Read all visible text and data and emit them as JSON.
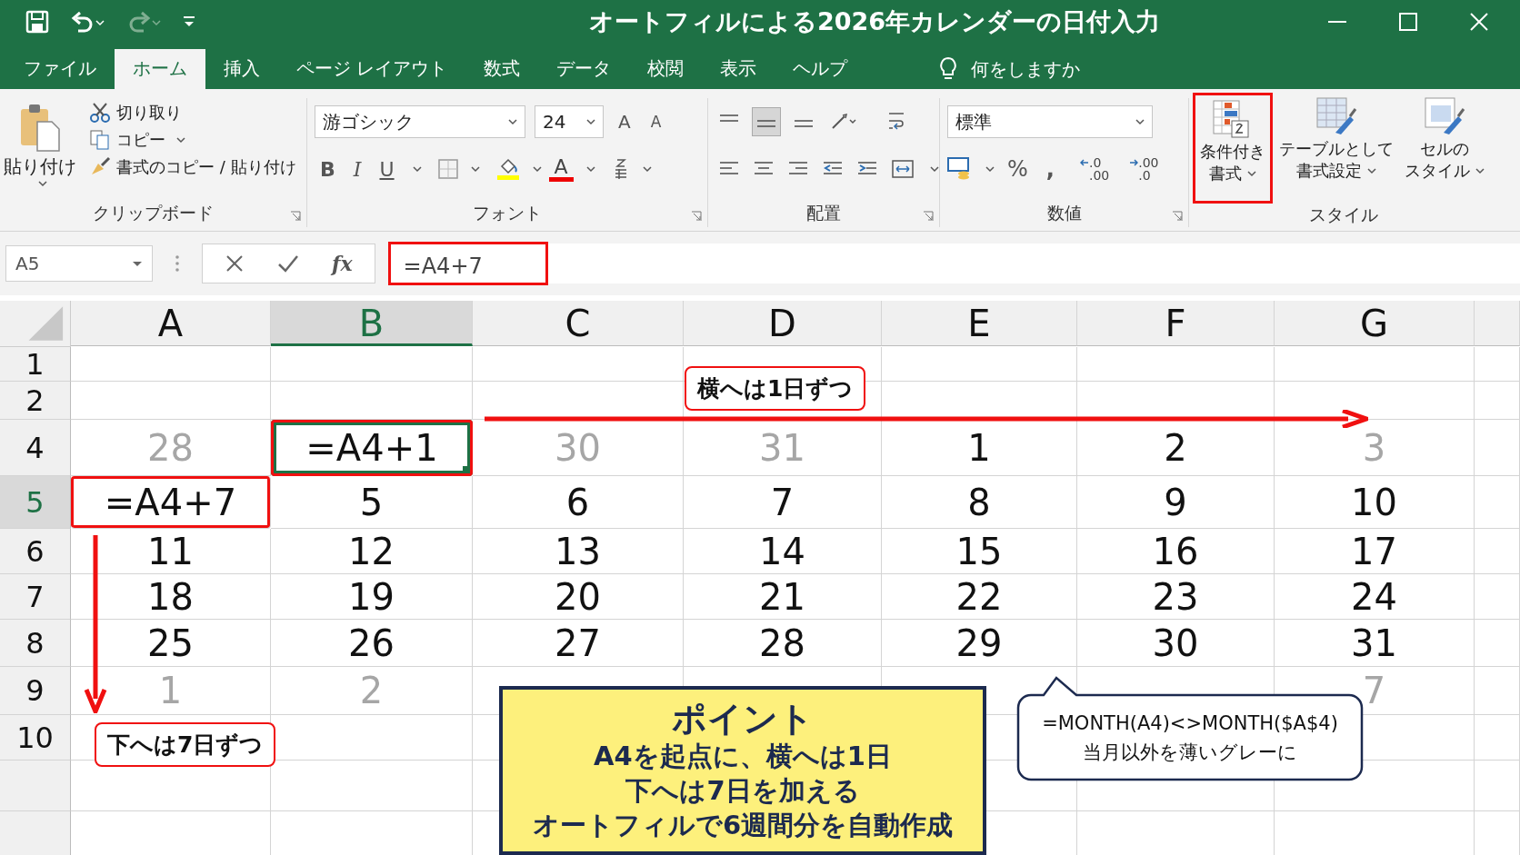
{
  "window": {
    "title": "オートフィルによる2026年カレンダーの日付入力"
  },
  "menu_tabs": [
    {
      "label": "ファイル",
      "selected": false
    },
    {
      "label": "ホーム",
      "selected": true
    },
    {
      "label": "挿入",
      "selected": false
    },
    {
      "label": "ページ レイアウト",
      "selected": false
    },
    {
      "label": "数式",
      "selected": false
    },
    {
      "label": "データ",
      "selected": false
    },
    {
      "label": "校閲",
      "selected": false
    },
    {
      "label": "表示",
      "selected": false
    },
    {
      "label": "ヘルプ",
      "selected": false
    }
  ],
  "tell_me": {
    "placeholder": "何をしますか"
  },
  "ribbon": {
    "clipboard": {
      "paste": "貼り付け",
      "cut": "切り取り",
      "copy": "コピー",
      "format_painter": "書式のコピー / 貼り付け",
      "label": "クリップボード"
    },
    "font": {
      "font_name": "游ゴシック",
      "font_size": "24",
      "grow": "A",
      "shrink": "A",
      "bold": "B",
      "italic": "I",
      "underline": "U",
      "font_color": "A",
      "label": "フォント"
    },
    "alignment": {
      "label": "配置"
    },
    "number": {
      "format": "標準",
      "percent": "%",
      "comma": ",",
      "increase_decimal": [
        ".0",
        ".00"
      ],
      "decrease_decimal": [
        ".00",
        ".0"
      ],
      "label": "数値"
    },
    "styles": {
      "buttons": [
        {
          "lines": [
            "条件付き",
            "書式"
          ],
          "highlighted": true
        },
        {
          "lines": [
            "テーブルとして",
            "書式設定"
          ],
          "highlighted": false
        },
        {
          "lines": [
            "セルの",
            "スタイル"
          ],
          "highlighted": false
        }
      ],
      "label": "スタイル"
    }
  },
  "formula_bar": {
    "name_box": "A5",
    "fx": "fx",
    "formula": "=A4+7",
    "highlighted": true
  },
  "sheet": {
    "columns": [
      {
        "label": "A",
        "selected": false
      },
      {
        "label": "B",
        "selected": true
      },
      {
        "label": "C",
        "selected": false
      },
      {
        "label": "D",
        "selected": false
      },
      {
        "label": "E",
        "selected": false
      },
      {
        "label": "F",
        "selected": false
      },
      {
        "label": "G",
        "selected": false
      }
    ],
    "rows": [
      {
        "header": "1",
        "selected": false,
        "cells": []
      },
      {
        "header": "2",
        "selected": false,
        "cells": []
      },
      {
        "header": "4",
        "selected": false,
        "cells": [
          {
            "text": "28",
            "muted": true
          },
          {
            "text": "=A4+1",
            "muted": false,
            "selected": true,
            "highlighted": true
          },
          {
            "text": "30",
            "muted": true
          },
          {
            "text": "31",
            "muted": true
          },
          {
            "text": "1",
            "muted": false
          },
          {
            "text": "2",
            "muted": false
          },
          {
            "text": "3",
            "muted": true
          }
        ]
      },
      {
        "header": "5",
        "selected": true,
        "cells": [
          {
            "text": "=A4+7",
            "muted": false,
            "highlighted": true
          },
          {
            "text": "5",
            "muted": false
          },
          {
            "text": "6",
            "muted": false
          },
          {
            "text": "7",
            "muted": false
          },
          {
            "text": "8",
            "muted": false
          },
          {
            "text": "9",
            "muted": false
          },
          {
            "text": "10",
            "muted": false
          }
        ]
      },
      {
        "header": "6",
        "selected": false,
        "cells": [
          {
            "text": "11",
            "muted": false
          },
          {
            "text": "12",
            "muted": false
          },
          {
            "text": "13",
            "muted": false
          },
          {
            "text": "14",
            "muted": false
          },
          {
            "text": "15",
            "muted": false
          },
          {
            "text": "16",
            "muted": false
          },
          {
            "text": "17",
            "muted": false
          }
        ]
      },
      {
        "header": "7",
        "selected": false,
        "cells": [
          {
            "text": "18",
            "muted": false
          },
          {
            "text": "19",
            "muted": false
          },
          {
            "text": "20",
            "muted": false
          },
          {
            "text": "21",
            "muted": false
          },
          {
            "text": "22",
            "muted": false
          },
          {
            "text": "23",
            "muted": false
          },
          {
            "text": "24",
            "muted": false
          }
        ]
      },
      {
        "header": "8",
        "selected": false,
        "cells": [
          {
            "text": "25",
            "muted": false
          },
          {
            "text": "26",
            "muted": false
          },
          {
            "text": "27",
            "muted": false
          },
          {
            "text": "28",
            "muted": false
          },
          {
            "text": "29",
            "muted": false
          },
          {
            "text": "30",
            "muted": false
          },
          {
            "text": "31",
            "muted": false
          }
        ]
      },
      {
        "header": "9",
        "selected": false,
        "cells": [
          {
            "text": "1",
            "muted": true
          },
          {
            "text": "2",
            "muted": true
          },
          null,
          null,
          null,
          null,
          {
            "text": "7",
            "muted": true
          }
        ]
      },
      {
        "header": "10",
        "selected": false,
        "cells": []
      }
    ]
  },
  "annotations": {
    "across_label": "横へは1日ずつ",
    "down_label": "下へは7日ずつ",
    "point": {
      "title": "ポイント",
      "lines": [
        "A4を起点に、横へは1日",
        "下へは7日を加える",
        "オートフィルで6週間分を自動作成"
      ]
    },
    "bubble": {
      "lines": [
        "=MONTH(A4)<>MONTH($A$4)",
        "当月以外を薄いグレーに"
      ]
    }
  }
}
